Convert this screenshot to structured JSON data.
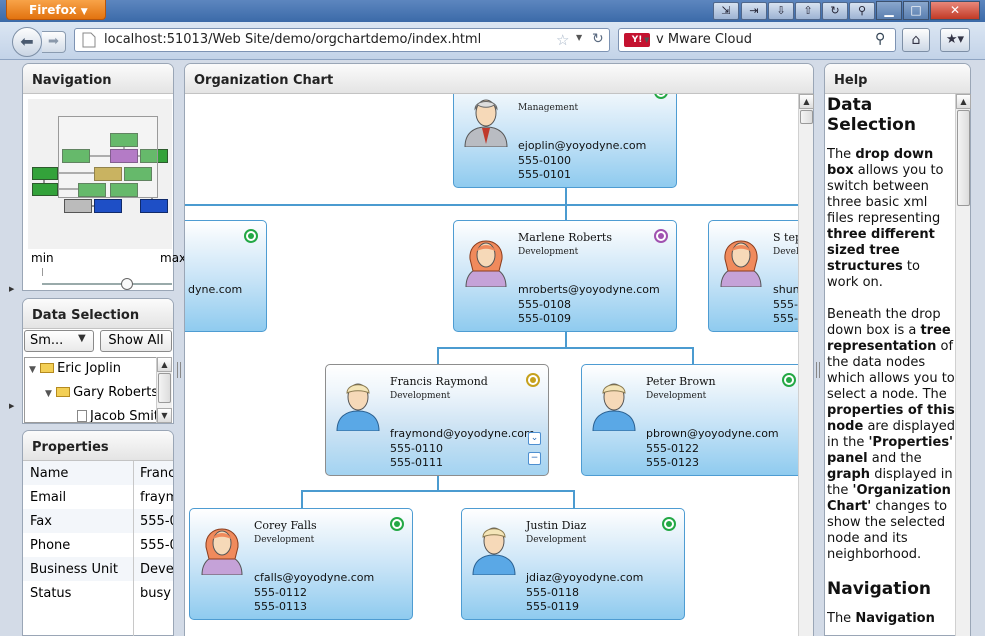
{
  "browser": {
    "menu_label": "Firefox",
    "url": "localhost:51013/Web Site/demo/orgchartdemo/index.html",
    "search_text": "v Mware Cloud",
    "search_engine": "Y!"
  },
  "panels": {
    "navigation": "Navigation",
    "data_selection": "Data Selection",
    "properties": "Properties",
    "org_chart": "Organization Chart",
    "help": "Help"
  },
  "navigation": {
    "min_label": "min",
    "max_label": "max",
    "zoom": 0.65
  },
  "data_selection": {
    "combo_value": "Sm...",
    "show_all": "Show All",
    "tree": [
      "Eric Joplin",
      "Gary Roberts",
      "Jacob Smit"
    ]
  },
  "properties": [
    {
      "key": "Name",
      "value": "Franc"
    },
    {
      "key": "Email",
      "value": "fraym"
    },
    {
      "key": "Fax",
      "value": "555-0"
    },
    {
      "key": "Phone",
      "value": "555-0"
    },
    {
      "key": "Business Unit",
      "value": "Deve"
    },
    {
      "key": "Status",
      "value": "busy"
    }
  ],
  "nodes": {
    "top": {
      "name": "",
      "unit": "Management",
      "email": "ejoplin@yoyodyne.com",
      "phone1": "555-0100",
      "phone2": "555-0101"
    },
    "left": {
      "email": "dyne.com"
    },
    "marlene": {
      "name": "Marlene Roberts",
      "unit": "Development",
      "email": "mroberts@yoyodyne.com",
      "phone1": "555-0108",
      "phone2": "555-0109"
    },
    "right": {
      "name": "S teph",
      "unit": "Devel",
      "email": "shun",
      "phone1": "555-0",
      "phone2": "555-0"
    },
    "francis": {
      "name": "Francis Raymond",
      "unit": "Development",
      "email": "fraymond@yoyodyne.com",
      "phone1": "555-0110",
      "phone2": "555-0111"
    },
    "peter": {
      "name": "Peter Brown",
      "unit": "Development",
      "email": "pbrown@yoyodyne.com",
      "phone1": "555-0122",
      "phone2": "555-0123"
    },
    "corey": {
      "name": "Corey Falls",
      "unit": "Development",
      "email": "cfalls@yoyodyne.com",
      "phone1": "555-0112",
      "phone2": "555-0113"
    },
    "justin": {
      "name": "Justin Diaz",
      "unit": "Development",
      "email": "jdiaz@yoyodyne.com",
      "phone1": "555-0118",
      "phone2": "555-0119"
    }
  },
  "help": {
    "title1": "Data Selection",
    "p1": [
      {
        "t": "The ",
        "b": false
      },
      {
        "t": "drop down box",
        "b": true
      },
      {
        "t": " allows you to switch between three basic xml files representing ",
        "b": false
      },
      {
        "t": "three different sized tree structures",
        "b": true
      },
      {
        "t": " to work on.",
        "b": false
      }
    ],
    "p2": [
      {
        "t": "Beneath the drop down box is a ",
        "b": false
      },
      {
        "t": "tree representation",
        "b": true
      },
      {
        "t": " of the data nodes which allows you to select a node. The ",
        "b": false
      },
      {
        "t": "properties of this node",
        "b": true
      },
      {
        "t": " are displayed in the ",
        "b": false
      },
      {
        "t": "'Properties' panel",
        "b": true
      },
      {
        "t": " and the ",
        "b": false
      },
      {
        "t": "graph",
        "b": true
      },
      {
        "t": " displayed in the ",
        "b": false
      },
      {
        "t": "'Organization Chart'",
        "b": true
      },
      {
        "t": " changes to show the selected node and its neighborhood.",
        "b": false
      }
    ],
    "title2": "Navigation",
    "p3": [
      {
        "t": "The ",
        "b": false
      },
      {
        "t": "Navigation",
        "b": true
      }
    ]
  },
  "colors": {
    "accent": "#4b9bd0",
    "status_green": "#23a845",
    "status_purple": "#a052b0",
    "status_yellow": "#c6a11d"
  }
}
